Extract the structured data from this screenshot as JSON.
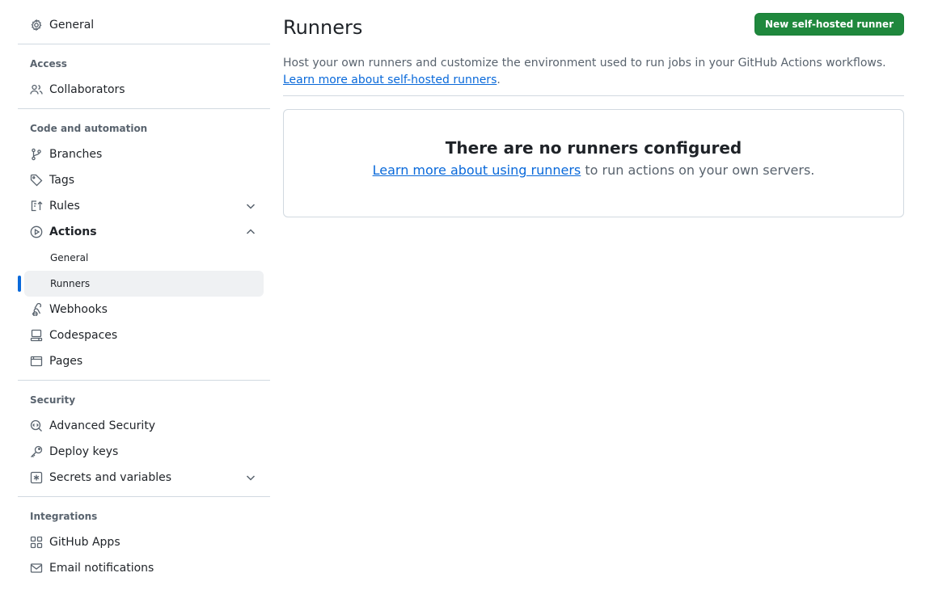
{
  "sidebar": {
    "general": "General",
    "access": {
      "title": "Access",
      "collaborators": "Collaborators"
    },
    "code_automation": {
      "title": "Code and automation",
      "branches": "Branches",
      "tags": "Tags",
      "rules": "Rules",
      "actions": "Actions",
      "actions_general": "General",
      "actions_runners": "Runners",
      "webhooks": "Webhooks",
      "codespaces": "Codespaces",
      "pages": "Pages"
    },
    "security": {
      "title": "Security",
      "advanced_security": "Advanced Security",
      "deploy_keys": "Deploy keys",
      "secrets_variables": "Secrets and variables"
    },
    "integrations": {
      "title": "Integrations",
      "github_apps": "GitHub Apps",
      "email_notifications": "Email notifications"
    }
  },
  "main": {
    "title": "Runners",
    "new_runner_button": "New self-hosted runner",
    "description": "Host your own runners and customize the environment used to run jobs in your GitHub Actions workflows.",
    "description_link": "Learn more about self-hosted runners",
    "description_end": ".",
    "empty_title": "There are no runners configured",
    "empty_link": "Learn more about using runners",
    "empty_text": "to run actions on your own servers."
  },
  "colors": {
    "accent": "#0969da",
    "primary_button": "#1f883d",
    "active_bg": "#eff1f3"
  }
}
